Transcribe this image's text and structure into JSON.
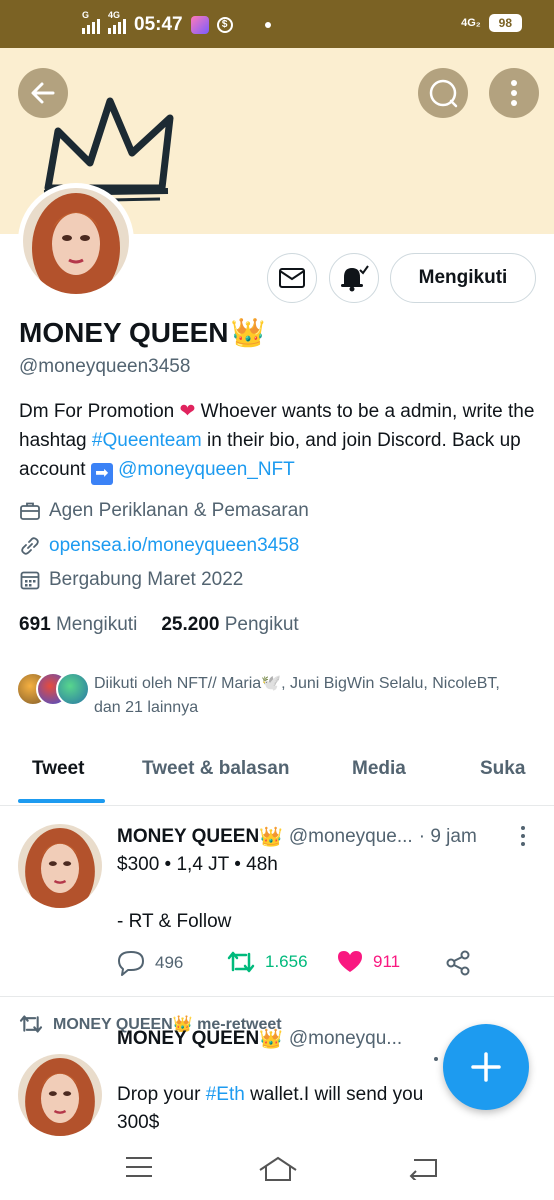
{
  "status_bar": {
    "signal1_label": "G",
    "signal2_label": "4G",
    "time": "05:47",
    "network": "4G₂",
    "battery": "98"
  },
  "header": {
    "back_icon": "arrow-left-icon",
    "search_icon": "search-icon",
    "more_icon": "more-vertical-icon"
  },
  "profile": {
    "follow_button": "Mengikuti",
    "display_name": "MONEY QUEEN",
    "name_emoji": "👑",
    "handle": "@moneyqueen3458",
    "bio": {
      "part1": "Dm For Promotion ",
      "heart": "❤",
      "part2": "  Whoever wants to be a admin, write the hashtag ",
      "hashtag": "#Queenteam",
      "part3": " in their bio,  and join Discord. Back up account  ",
      "arrow": "➡",
      "mention": "@moneyqueen_NFT"
    },
    "category": "Agen Periklanan & Pemasaran",
    "website": "opensea.io/moneyqueen3458",
    "joined": "Bergabung Maret 2022",
    "following_count": "691",
    "following_label": "Mengikuti",
    "followers_count": "25.200",
    "followers_label": "Pengikut",
    "followed_by": "Diikuti oleh NFT// Maria🕊️, Juni BigWin Selalu, NicoleBT, dan 21 lainnya"
  },
  "tabs": [
    {
      "label": "Tweet"
    },
    {
      "label": "Tweet & balasan"
    },
    {
      "label": "Media"
    },
    {
      "label": "Suka"
    }
  ],
  "tweets": [
    {
      "name": "MONEY QUEEN",
      "emoji": "👑",
      "handle": "@moneyque...",
      "time": "· 9 jam",
      "line1": "$300 • 1,4 JT • 48h",
      "line2": "- RT & Follow",
      "replies": "496",
      "retweets": "1.656",
      "likes": "911"
    },
    {
      "retweet_by": "MONEY QUEEN",
      "retweet_emoji": "👑",
      "retweet_label": "me-retweet",
      "name": "MONEY QUEEN",
      "emoji": "👑",
      "handle": "@moneyqu...",
      "text_a": "Drop your ",
      "hashtag": "#Eth",
      "text_b": " wallet.I will send you",
      "line2": "300$"
    }
  ],
  "colors": {
    "accent": "#1d9bf0",
    "status_bar": "#7b6224",
    "banner": "#fbeed0",
    "retweet_green": "#00ba7c",
    "like_pink": "#f91880"
  }
}
